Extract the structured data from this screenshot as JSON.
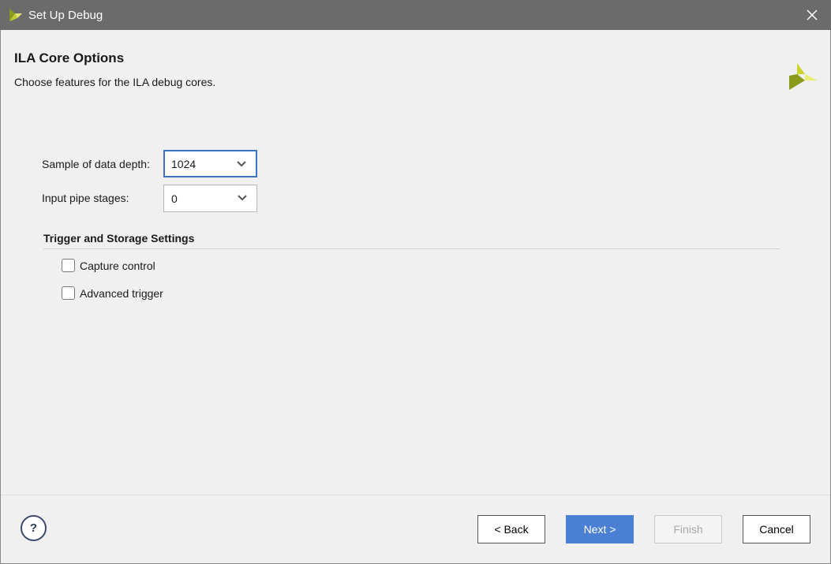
{
  "window": {
    "title": "Set Up Debug",
    "icons": {
      "app": "vivado-logo-icon",
      "close": "close-icon"
    }
  },
  "header": {
    "title": "ILA Core Options",
    "subtitle": "Choose features for the ILA debug cores.",
    "logo_icon": "vivado-logo-icon"
  },
  "form": {
    "depth_label": "Sample of data depth:",
    "depth_value": "1024",
    "pipe_label": "Input pipe stages:",
    "pipe_value": "0"
  },
  "trigger_section": {
    "title": "Trigger and Storage Settings",
    "options": [
      {
        "label": "Capture control",
        "checked": false
      },
      {
        "label": "Advanced trigger",
        "checked": false
      }
    ]
  },
  "footer": {
    "help_label": "?",
    "back_label": "< Back",
    "next_label": "Next >",
    "finish_label": "Finish",
    "cancel_label": "Cancel"
  },
  "colors": {
    "titlebar": "#6b6b6b",
    "primary_button": "#4a7fd4",
    "focus_border": "#3b74c9"
  }
}
